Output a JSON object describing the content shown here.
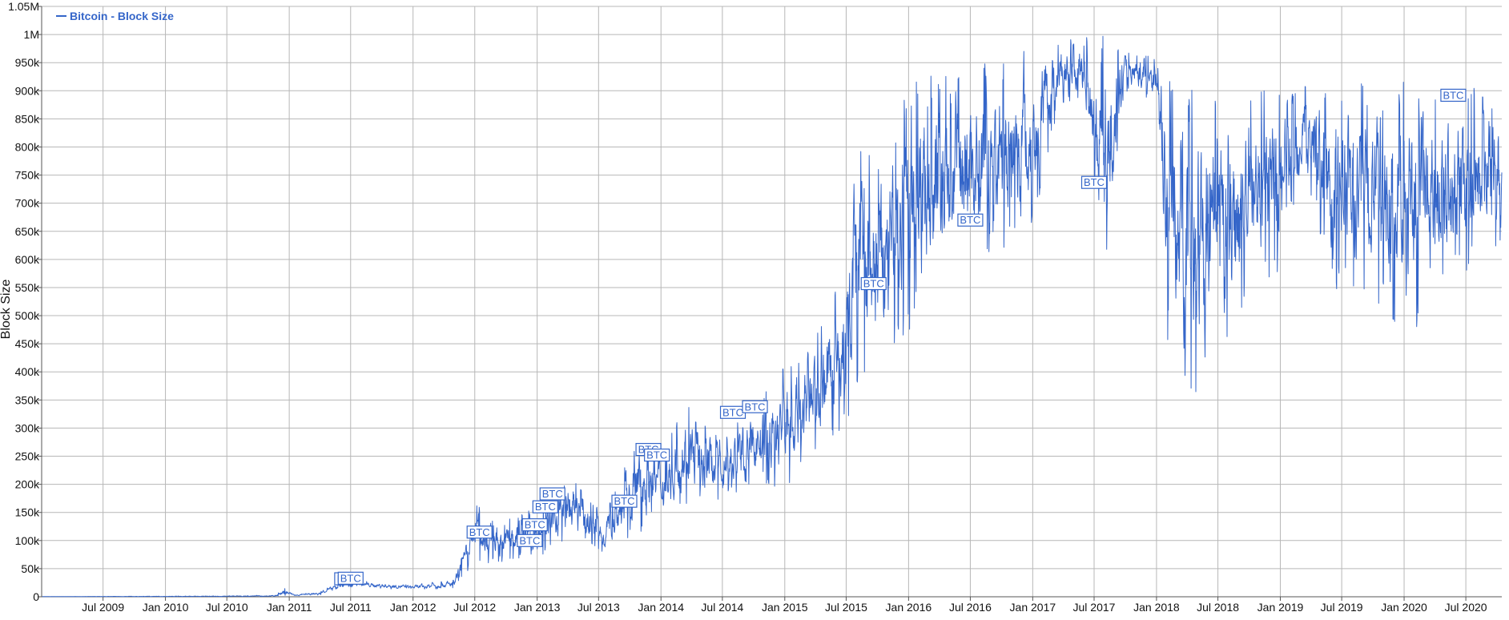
{
  "chart_data": {
    "type": "line",
    "legend": {
      "label": "Bitcoin - Block Size",
      "position": "top-left"
    },
    "ylabel": "Block Size",
    "xlabel": "",
    "ylim": [
      0,
      1050000
    ],
    "xlim": [
      "2009-01-01",
      "2020-10-15"
    ],
    "grid": true,
    "colors": {
      "line": "#3566c9",
      "grid": "#b7b7b7",
      "axis": "#555555",
      "text": "#111111"
    },
    "y_ticks": [
      {
        "value": 0,
        "label": "0"
      },
      {
        "value": 50000,
        "label": "50k"
      },
      {
        "value": 100000,
        "label": "100k"
      },
      {
        "value": 150000,
        "label": "150k"
      },
      {
        "value": 200000,
        "label": "200k"
      },
      {
        "value": 250000,
        "label": "250k"
      },
      {
        "value": 300000,
        "label": "300k"
      },
      {
        "value": 350000,
        "label": "350k"
      },
      {
        "value": 400000,
        "label": "400k"
      },
      {
        "value": 450000,
        "label": "450k"
      },
      {
        "value": 500000,
        "label": "500k"
      },
      {
        "value": 550000,
        "label": "550k"
      },
      {
        "value": 600000,
        "label": "600k"
      },
      {
        "value": 650000,
        "label": "650k"
      },
      {
        "value": 700000,
        "label": "700k"
      },
      {
        "value": 750000,
        "label": "750k"
      },
      {
        "value": 800000,
        "label": "800k"
      },
      {
        "value": 850000,
        "label": "850k"
      },
      {
        "value": 900000,
        "label": "900k"
      },
      {
        "value": 950000,
        "label": "950k"
      },
      {
        "value": 1000000,
        "label": "1M"
      },
      {
        "value": 1050000,
        "label": "1.05M"
      }
    ],
    "x_ticks": [
      {
        "date": "2009-07-01",
        "label": "Jul 2009"
      },
      {
        "date": "2010-01-01",
        "label": "Jan 2010"
      },
      {
        "date": "2010-07-01",
        "label": "Jul 2010"
      },
      {
        "date": "2011-01-01",
        "label": "Jan 2011"
      },
      {
        "date": "2011-07-01",
        "label": "Jul 2011"
      },
      {
        "date": "2012-01-01",
        "label": "Jan 2012"
      },
      {
        "date": "2012-07-01",
        "label": "Jul 2012"
      },
      {
        "date": "2013-01-01",
        "label": "Jan 2013"
      },
      {
        "date": "2013-07-01",
        "label": "Jul 2013"
      },
      {
        "date": "2014-01-01",
        "label": "Jan 2014"
      },
      {
        "date": "2014-07-01",
        "label": "Jul 2014"
      },
      {
        "date": "2015-01-01",
        "label": "Jan 2015"
      },
      {
        "date": "2015-07-01",
        "label": "Jul 2015"
      },
      {
        "date": "2016-01-01",
        "label": "Jan 2016"
      },
      {
        "date": "2016-07-01",
        "label": "Jul 2016"
      },
      {
        "date": "2017-01-01",
        "label": "Jan 2017"
      },
      {
        "date": "2017-07-01",
        "label": "Jul 2017"
      },
      {
        "date": "2018-01-01",
        "label": "Jan 2018"
      },
      {
        "date": "2018-07-01",
        "label": "Jul 2018"
      },
      {
        "date": "2019-01-01",
        "label": "Jan 2019"
      },
      {
        "date": "2019-07-01",
        "label": "Jul 2019"
      },
      {
        "date": "2020-01-01",
        "label": "Jan 2020"
      },
      {
        "date": "2020-07-01",
        "label": "Jul 2020"
      }
    ],
    "series": [
      {
        "name": "Bitcoin - Block Size",
        "envelope": [
          {
            "date": "2009-01-03",
            "low": 200,
            "high": 300
          },
          {
            "date": "2010-06-01",
            "low": 200,
            "high": 1500
          },
          {
            "date": "2010-11-20",
            "low": 300,
            "high": 3000
          },
          {
            "date": "2010-12-20",
            "low": 500,
            "high": 16000
          },
          {
            "date": "2011-01-20",
            "low": 1000,
            "high": 4000
          },
          {
            "date": "2011-04-01",
            "low": 3000,
            "high": 9000
          },
          {
            "date": "2011-06-15",
            "low": 18000,
            "high": 32000
          },
          {
            "date": "2011-09-01",
            "low": 15000,
            "high": 26000
          },
          {
            "date": "2012-01-01",
            "low": 12000,
            "high": 22000
          },
          {
            "date": "2012-05-01",
            "low": 15000,
            "high": 30000
          },
          {
            "date": "2012-06-15",
            "low": 50000,
            "high": 115000
          },
          {
            "date": "2012-07-05",
            "low": 60000,
            "high": 180000
          },
          {
            "date": "2012-09-01",
            "low": 60000,
            "high": 130000
          },
          {
            "date": "2013-01-01",
            "low": 70000,
            "high": 160000
          },
          {
            "date": "2013-04-15",
            "low": 100000,
            "high": 220000
          },
          {
            "date": "2013-07-15",
            "low": 75000,
            "high": 150000
          },
          {
            "date": "2013-11-15",
            "low": 120000,
            "high": 310000
          },
          {
            "date": "2014-01-15",
            "low": 140000,
            "high": 260000
          },
          {
            "date": "2014-03-01",
            "low": 160000,
            "high": 355000
          },
          {
            "date": "2014-07-01",
            "low": 170000,
            "high": 290000
          },
          {
            "date": "2014-10-15",
            "low": 200000,
            "high": 350000
          },
          {
            "date": "2015-01-01",
            "low": 190000,
            "high": 420000
          },
          {
            "date": "2015-04-01",
            "low": 260000,
            "high": 460000
          },
          {
            "date": "2015-07-01",
            "low": 290000,
            "high": 600000
          },
          {
            "date": "2015-07-20",
            "low": 350000,
            "high": 840000
          },
          {
            "date": "2015-10-01",
            "low": 380000,
            "high": 780000
          },
          {
            "date": "2016-01-15",
            "low": 480000,
            "high": 920000
          },
          {
            "date": "2016-07-01",
            "low": 580000,
            "high": 960000
          },
          {
            "date": "2017-01-01",
            "low": 650000,
            "high": 980000
          },
          {
            "date": "2017-03-15",
            "low": 860000,
            "high": 995000
          },
          {
            "date": "2017-06-01",
            "low": 880000,
            "high": 995000
          },
          {
            "date": "2017-08-01",
            "low": 570000,
            "high": 1000000
          },
          {
            "date": "2017-10-01",
            "low": 900000,
            "high": 975000
          },
          {
            "date": "2018-01-01",
            "low": 880000,
            "high": 960000
          },
          {
            "date": "2018-02-05",
            "low": 430000,
            "high": 920000
          },
          {
            "date": "2018-04-01",
            "low": 360000,
            "high": 940000
          },
          {
            "date": "2018-07-01",
            "low": 370000,
            "high": 880000
          },
          {
            "date": "2018-10-01",
            "low": 560000,
            "high": 900000
          },
          {
            "date": "2019-01-01",
            "low": 560000,
            "high": 910000
          },
          {
            "date": "2019-03-15",
            "low": 760000,
            "high": 930000
          },
          {
            "date": "2019-06-01",
            "low": 550000,
            "high": 920000
          },
          {
            "date": "2019-10-01",
            "low": 530000,
            "high": 910000
          },
          {
            "date": "2020-01-01",
            "low": 440000,
            "high": 920000
          },
          {
            "date": "2020-05-01",
            "low": 550000,
            "high": 910000
          },
          {
            "date": "2020-10-15",
            "low": 630000,
            "high": 900000
          }
        ]
      }
    ],
    "annotations": [
      {
        "date": "2011-06-10",
        "value": 32000,
        "label": "BT"
      },
      {
        "date": "2011-07-01",
        "value": 33000,
        "label": "BTC"
      },
      {
        "date": "2012-07-15",
        "value": 115000,
        "label": "BTC"
      },
      {
        "date": "2012-12-10",
        "value": 100000,
        "label": "BTC"
      },
      {
        "date": "2012-12-25",
        "value": 128000,
        "label": "BTC"
      },
      {
        "date": "2013-01-25",
        "value": 160000,
        "label": "BTC"
      },
      {
        "date": "2013-02-15",
        "value": 183000,
        "label": "BTC"
      },
      {
        "date": "2013-09-15",
        "value": 170000,
        "label": "BTC"
      },
      {
        "date": "2013-11-25",
        "value": 262000,
        "label": "BTC"
      },
      {
        "date": "2013-12-20",
        "value": 252000,
        "label": "BTC"
      },
      {
        "date": "2014-08-01",
        "value": 328000,
        "label": "BTC"
      },
      {
        "date": "2014-10-05",
        "value": 338000,
        "label": "BTC"
      },
      {
        "date": "2015-09-20",
        "value": 557000,
        "label": "BTC"
      },
      {
        "date": "2016-07-01",
        "value": 670000,
        "label": "BTC"
      },
      {
        "date": "2017-07-01",
        "value": 737000,
        "label": "BTC"
      },
      {
        "date": "2020-05-25",
        "value": 892000,
        "label": "BTC"
      }
    ]
  }
}
